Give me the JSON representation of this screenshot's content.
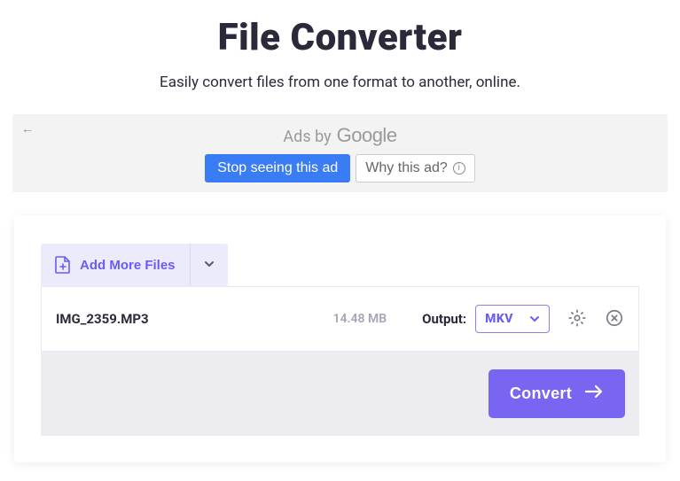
{
  "header": {
    "title": "File Converter",
    "subtitle": "Easily convert files from one format to another, online."
  },
  "ad": {
    "by_label": "Ads by",
    "provider": "Google",
    "stop_label": "Stop seeing this ad",
    "why_label": "Why this ad?"
  },
  "toolbar": {
    "add_more_label": "Add More Files"
  },
  "file": {
    "name": "IMG_2359.MP3",
    "size": "14.48 MB",
    "output_label": "Output:",
    "output_value": "MKV"
  },
  "actions": {
    "convert_label": "Convert"
  }
}
